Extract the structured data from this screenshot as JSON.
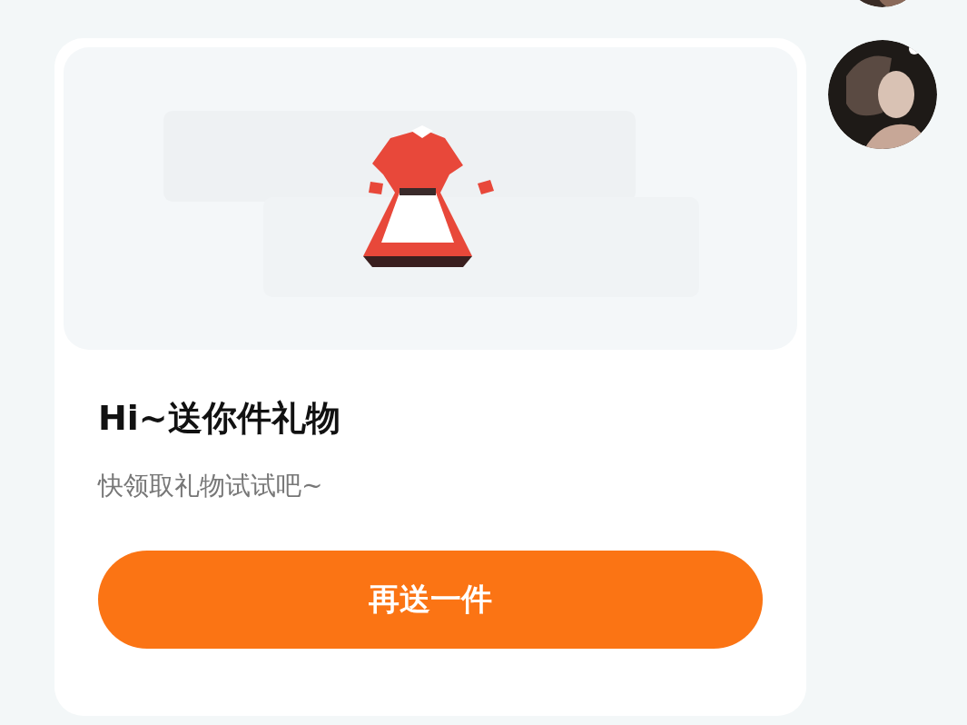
{
  "message": {
    "title": "Hi~送你件礼物",
    "subtitle": "快领取礼物试试吧~",
    "button": "再送一件"
  }
}
